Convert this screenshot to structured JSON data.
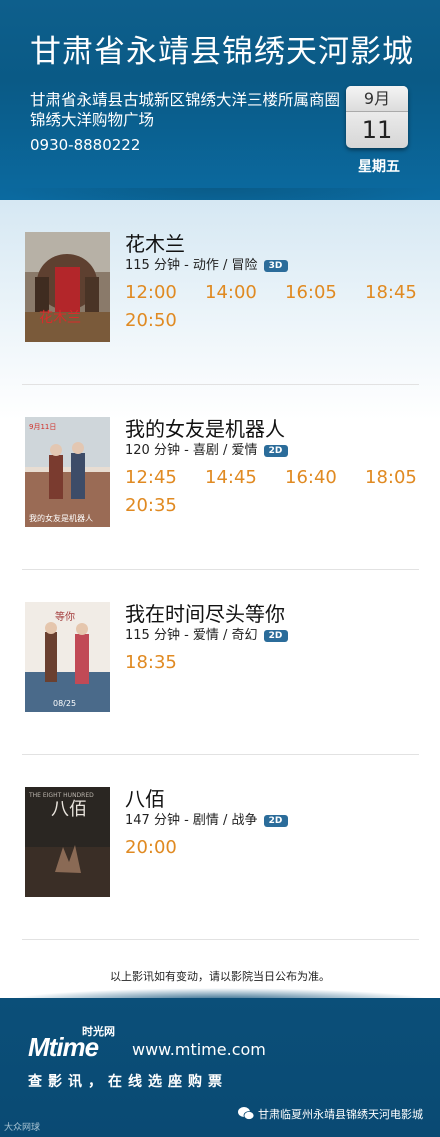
{
  "header": {
    "cinema_name": "甘肃省永靖县锦绣天河影城",
    "address": "甘肃省永靖县古城新区锦绣大洋三楼所属商圈锦绣大洋购物广场",
    "phone": "0930-8880222",
    "month": "9月",
    "day": "11",
    "weekday": "星期五"
  },
  "movies": [
    {
      "title": "花木兰",
      "info": "115 分钟 - 动作 / 冒险",
      "format": "3D",
      "times": [
        "12:00",
        "14:00",
        "16:05",
        "18:45",
        "20:50"
      ]
    },
    {
      "title": "我的女友是机器人",
      "info": "120 分钟 - 喜剧 / 爱情",
      "format": "2D",
      "times": [
        "12:45",
        "14:45",
        "16:40",
        "18:05",
        "20:35"
      ]
    },
    {
      "title": "我在时间尽头等你",
      "info": "115 分钟 - 爱情 / 奇幻",
      "format": "2D",
      "times": [
        "18:35"
      ]
    },
    {
      "title": "八佰",
      "info": "147 分钟 - 剧情 / 战争",
      "format": "2D",
      "times": [
        "20:00"
      ]
    }
  ],
  "notice": "以上影讯如有变动，请以影院当日公布为准。",
  "footer": {
    "logo_cn": "时光网",
    "logo_text": "Mtime",
    "site": "www.mtime.com",
    "slogan": "查影讯，在线选座购票",
    "wechat": "甘肃临夏州永靖县锦绣天河电影城",
    "watermark": "大众网球"
  },
  "colors": {
    "header_blue": "#0a5a86",
    "time_orange": "#e08a22",
    "badge_blue": "#2b6c9a"
  }
}
